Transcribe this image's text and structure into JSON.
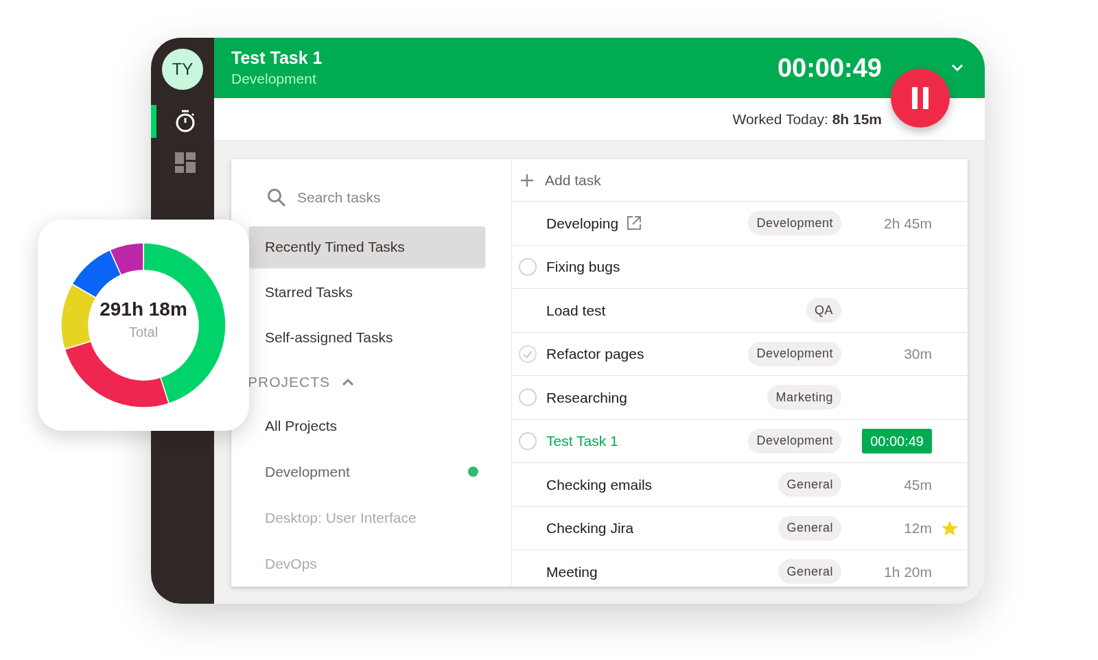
{
  "user": {
    "initials": "TY"
  },
  "nav": [
    {
      "kind": "timer",
      "selected": true
    },
    {
      "kind": "dashboard",
      "selected": false
    }
  ],
  "header": {
    "title": "Test Task 1",
    "project": "Development",
    "timer": "00:00:49",
    "running": true,
    "worked_label": "Worked Today:",
    "worked_value": "8h 15m"
  },
  "search": {
    "placeholder": "Search tasks"
  },
  "filters": [
    {
      "label": "Recently Timed Tasks",
      "selected": true
    },
    {
      "label": "Starred Tasks",
      "selected": false
    },
    {
      "label": "Self-assigned Tasks",
      "selected": false
    }
  ],
  "projects": {
    "heading": "PROJECTS",
    "expanded": true,
    "items": [
      {
        "label": "All Projects",
        "selected": true,
        "faded": false
      },
      {
        "label": "Development",
        "selected": false,
        "faded": false,
        "color": "#2dbd6e"
      },
      {
        "label": "Desktop: User Interface",
        "selected": false,
        "faded": true
      },
      {
        "label": "DevOps",
        "selected": false,
        "faded": true
      }
    ]
  },
  "add_task": "Add task",
  "tasks": [
    {
      "name": "Developing",
      "link": true,
      "tag": "Development",
      "time": "2h 45m",
      "active": false,
      "starred": false
    },
    {
      "name": "Fixing bugs",
      "link": false,
      "checked": false,
      "active": false,
      "starred": false
    },
    {
      "name": "Load test",
      "link": false,
      "tag": "QA",
      "active": false,
      "starred": false
    },
    {
      "name": "Refactor pages",
      "link": false,
      "checked": true,
      "tag": "Development",
      "time": "30m",
      "active": false,
      "starred": false
    },
    {
      "name": "Researching",
      "link": false,
      "checked": false,
      "tag": "Marketing",
      "active": false,
      "starred": false
    },
    {
      "name": "Test Task 1",
      "link": false,
      "checked": false,
      "tag": "Development",
      "time": "00:00:49",
      "active": true,
      "starred": false
    },
    {
      "name": "Checking emails",
      "link": false,
      "tag": "General",
      "time": "45m",
      "active": false,
      "starred": false
    },
    {
      "name": "Checking Jira",
      "link": false,
      "tag": "General",
      "time": "12m",
      "active": false,
      "starred": true
    },
    {
      "name": "Meeting",
      "link": false,
      "tag": "General",
      "time": "1h 20m",
      "active": false,
      "starred": false
    }
  ],
  "summary": {
    "total": "291h 18m",
    "label": "Total"
  }
}
